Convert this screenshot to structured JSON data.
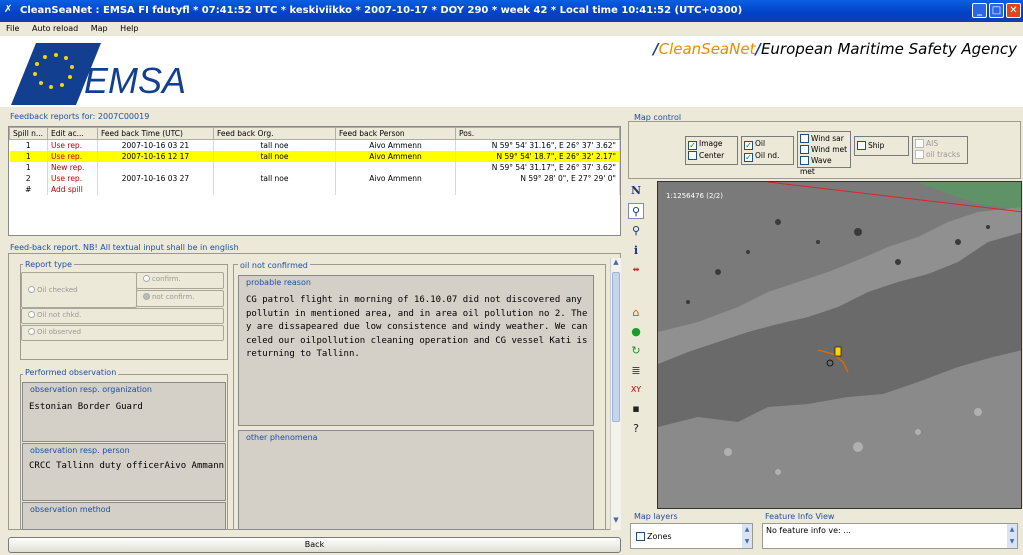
{
  "window": {
    "title": "CleanSeaNet :  EMSA FI fdutyfl   *  07:41:52 UTC   *   keskiviikko   *   2007-10-17   *   DOY 290   *   week 42   *   Local time 10:41:52  (UTC+0300)",
    "icon": "app-icon",
    "controls": [
      "_",
      "□",
      "✕"
    ]
  },
  "menu": [
    "File",
    "Auto reload",
    "Map",
    "Help"
  ],
  "header": {
    "logo_text": "EMSA",
    "brand_prefix": "/",
    "brand_csn": "CleanSeaNet",
    "brand_slash": "/",
    "brand_agency": "European Maritime Safety Agency"
  },
  "feedback": {
    "title": "Feedback reports for: 2007C00019",
    "columns": [
      "Spill n...",
      "Edit ac...",
      "Feed back Time (UTC)",
      "Feed back Org.",
      "Feed back Person",
      "Pos."
    ],
    "rows": [
      {
        "spill": "1",
        "action": "Use rep.",
        "time": "2007-10-16 03 21",
        "org": "tall noe",
        "person": "Aivo Ammenn",
        "pos": "N 59° 54' 31.16\", E 26° 37' 3.62\"",
        "selected": false
      },
      {
        "spill": "1",
        "action": "Use rep.",
        "time": "2007-10-16 12 17",
        "org": "tall noe",
        "person": "Aivo Ammenn",
        "pos": "N 59° 54' 18.7\", E 26° 32' 2.17\"",
        "selected": true
      },
      {
        "spill": "1",
        "action": "New rep.",
        "time": "",
        "org": "",
        "person": "",
        "pos": "N 59° 54' 31.17\", E 26° 37' 3.62\"",
        "selected": false
      },
      {
        "spill": "2",
        "action": "Use rep.",
        "time": "2007-10-16 03 27",
        "org": "tall noe",
        "person": "Aivo Ammenn",
        "pos": "N 59° 28' 0\", E 27° 29' 0\"",
        "selected": false
      },
      {
        "spill": "#",
        "action": "Add spill",
        "time": "",
        "org": "",
        "person": "",
        "pos": "",
        "selected": false
      }
    ]
  },
  "form": {
    "title": "Feed-back report. NB! All textual input shall be in english",
    "report_type": {
      "label": "Report type",
      "oil_checked": "Oil checked",
      "confirm": "confirm.",
      "not_confirm": "not confirm.",
      "oil_not_chkd": "Oil not chkd.",
      "oil_observed": "Oil observed"
    },
    "performed_observation": {
      "label": "Performed observation",
      "org_label": "observation resp. organization",
      "org_value": "Estonian Border Guard",
      "person_label": "observation resp. person",
      "person_value": "CRCC Tallinn duty officerAivo Ammann",
      "method_label": "observation method"
    },
    "oil_not_confirmed": {
      "label": "oil not confirmed",
      "reason_label": "probable reason",
      "reason_text": "CG patrol flight in morning of 16.10.07 did not discovered any pollutin in mentioned area, and in area oil pollution no 2. They are dissapeared due low consistence and windy weather. We canceled our oilpollution cleaning operation and CG vessel Kati is returning to Tallinn.",
      "other_label": "other phenomena"
    },
    "back_button": "Back"
  },
  "map_control": {
    "label": "Map control",
    "image": "Image",
    "center": "Center",
    "oil": "Oil",
    "oil_nd": "Oil nd.",
    "wind_sar": "Wind sar",
    "wind_met": "Wind met",
    "wave_met": "Wave met",
    "ship": "Ship",
    "ais": "AIS",
    "oil_tracks": "oil tracks",
    "scale": "1:1256476 (2/2)"
  },
  "tools": [
    "north-arrow",
    "zoom-in",
    "zoom-out",
    "info",
    "measure",
    "home",
    "forward",
    "refresh",
    "layers",
    "xy",
    "save",
    "help"
  ],
  "map_layers": {
    "label": "Map layers",
    "zones": "Zones"
  },
  "feature_info": {
    "label": "Feature Info View",
    "value": "No feature info ve: ..."
  }
}
